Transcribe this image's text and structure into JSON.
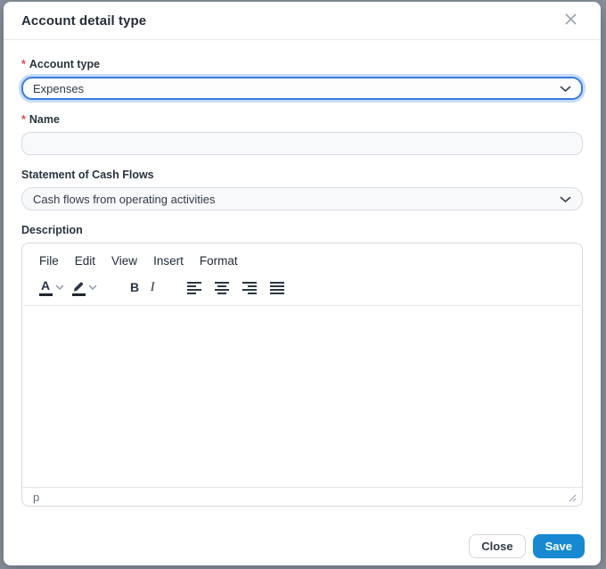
{
  "dialog": {
    "title": "Account detail type"
  },
  "fields": {
    "account_type": {
      "label": "Account type",
      "required_marker": "*",
      "value": "Expenses"
    },
    "name": {
      "label": "Name",
      "required_marker": "*",
      "value": "",
      "placeholder": ""
    },
    "cash_flow": {
      "label": "Statement of Cash Flows",
      "value": "Cash flows from operating activities"
    },
    "description": {
      "label": "Description"
    }
  },
  "editor": {
    "menu_items": [
      "File",
      "Edit",
      "View",
      "Insert",
      "Format"
    ],
    "toolbar": {
      "text_color_letter": "A",
      "bold_label": "B",
      "italic_label": "I"
    },
    "status_bar": {
      "element_path": "p"
    }
  },
  "footer": {
    "close_label": "Close",
    "save_label": "Save"
  },
  "colors": {
    "focus_border": "#3b7ce0",
    "save_button": "#1789d3",
    "required_red": "#e5484d",
    "backdrop": "#8b929e",
    "icon_dark": "#2c3645"
  }
}
